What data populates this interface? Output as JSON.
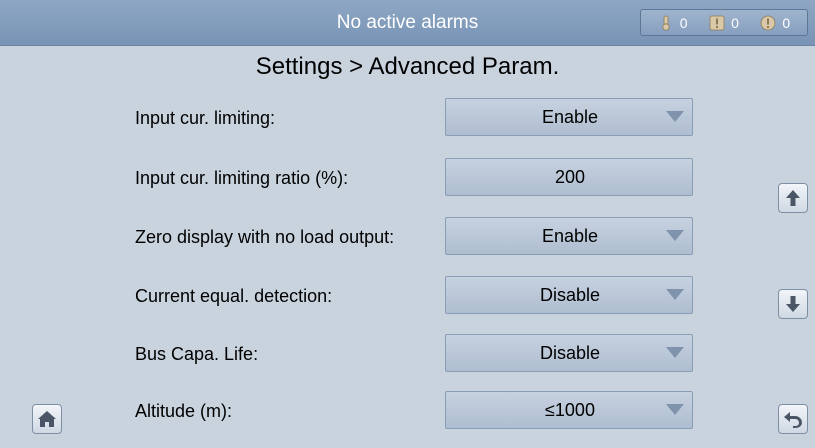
{
  "header": {
    "alarm_status": "No active alarms",
    "counts": [
      {
        "icon": "thermometer-alarm-icon",
        "value": "0"
      },
      {
        "icon": "exclamation-square-icon",
        "value": "0"
      },
      {
        "icon": "exclamation-circle-icon",
        "value": "0"
      }
    ]
  },
  "page": {
    "title": "Settings > Advanced Param."
  },
  "params": [
    {
      "label": "Input cur. limiting:",
      "value": "Enable",
      "dropdown": true
    },
    {
      "label": "Input cur. limiting ratio (%):",
      "value": "200",
      "dropdown": false
    },
    {
      "label": "Zero display with no load output:",
      "value": "Enable",
      "dropdown": true
    },
    {
      "label": "Current equal. detection:",
      "value": "Disable",
      "dropdown": true
    },
    {
      "label": "Bus Capa. Life:",
      "value": "Disable",
      "dropdown": true
    },
    {
      "label": "Altitude (m):",
      "value": "≤1000",
      "dropdown": true
    }
  ],
  "nav": {
    "home_icon": "home-icon",
    "scroll_up_icon": "arrow-up-icon",
    "scroll_down_icon": "arrow-down-icon",
    "back_icon": "back-arrow-icon"
  }
}
